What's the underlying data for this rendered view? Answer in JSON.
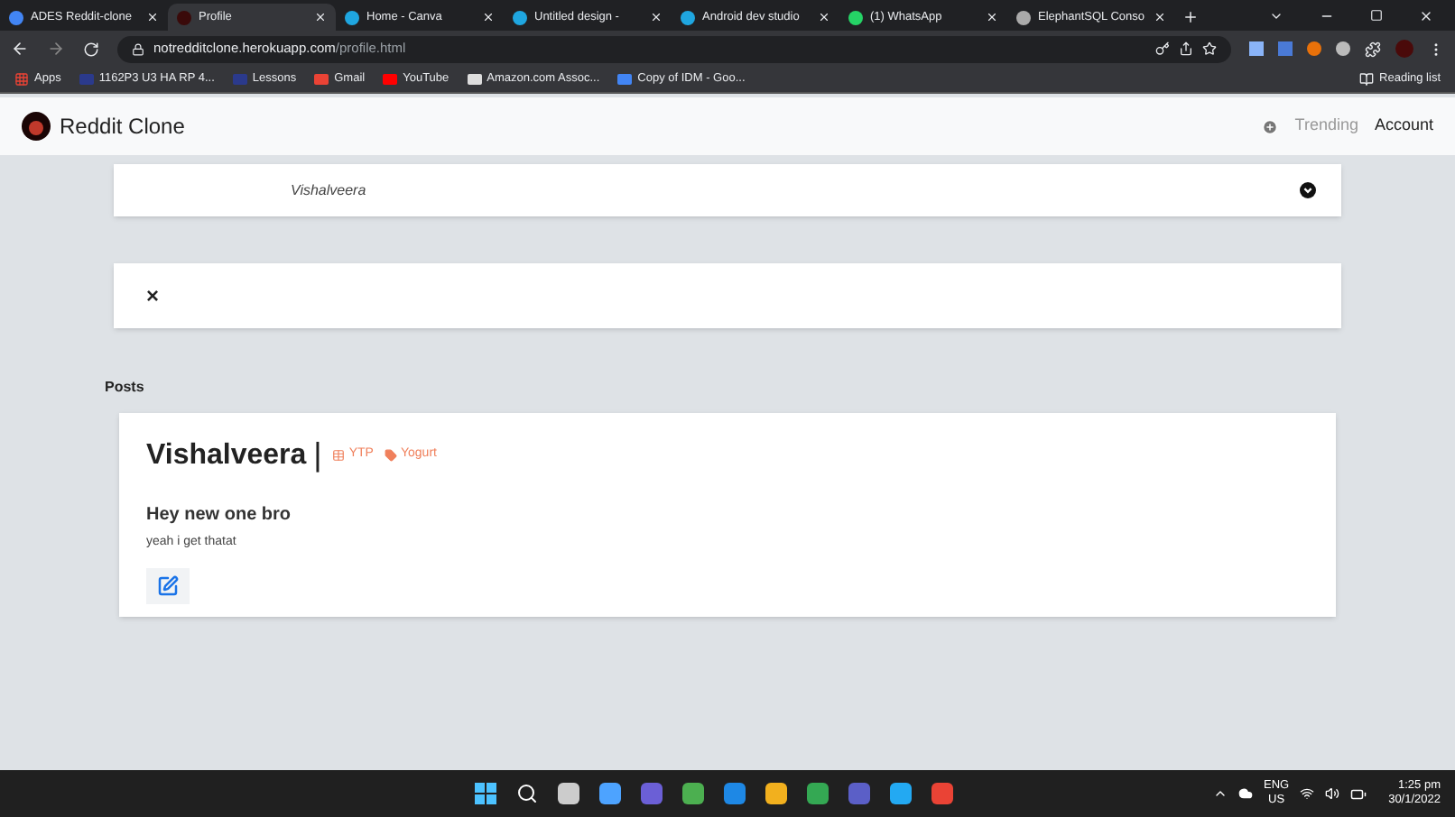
{
  "browser": {
    "tabs": [
      {
        "title": "ADES Reddit-clone",
        "selected": false,
        "kind": "doc"
      },
      {
        "title": "Profile",
        "selected": true,
        "kind": "reddit"
      },
      {
        "title": "Home - Canva",
        "selected": false,
        "kind": "canva"
      },
      {
        "title": "Untitled design -",
        "selected": false,
        "kind": "canva"
      },
      {
        "title": "Android dev studio",
        "selected": false,
        "kind": "canva"
      },
      {
        "title": "(1) WhatsApp",
        "selected": false,
        "kind": "whatsapp"
      },
      {
        "title": "ElephantSQL Conso",
        "selected": false,
        "kind": "elephant"
      }
    ],
    "url_host": "notredditclone.herokuapp.com",
    "url_path": "/profile.html",
    "bookmarks": [
      {
        "label": "Apps",
        "kind": "apps"
      },
      {
        "label": "1162P3 U3 HA RP 4...",
        "kind": "site"
      },
      {
        "label": "Lessons",
        "kind": "site"
      },
      {
        "label": "Gmail",
        "kind": "gmail"
      },
      {
        "label": "YouTube",
        "kind": "youtube"
      },
      {
        "label": "Amazon.com Assoc...",
        "kind": "amazon"
      },
      {
        "label": "Copy of IDM - Goo...",
        "kind": "doc"
      }
    ],
    "reading_list": "Reading list"
  },
  "navbar": {
    "brand": "Reddit Clone",
    "links": [
      {
        "label": "Trending",
        "selected": false
      },
      {
        "label": "Account",
        "selected": true
      }
    ]
  },
  "profile_select": {
    "value": "Vishalveera"
  },
  "close_symbol": "×",
  "posts_heading": "Posts",
  "posts": [
    {
      "author": "Vishalveera",
      "separator": "|",
      "tags": [
        {
          "label": "YTP",
          "kind": "table"
        },
        {
          "label": "Yogurt",
          "kind": "tag"
        }
      ],
      "title": "Hey new one bro",
      "body": "yeah i get thatat"
    }
  ],
  "taskbar": {
    "lang": "ENG",
    "region": "US",
    "time": "1:25 pm",
    "date": "30/1/2022"
  }
}
